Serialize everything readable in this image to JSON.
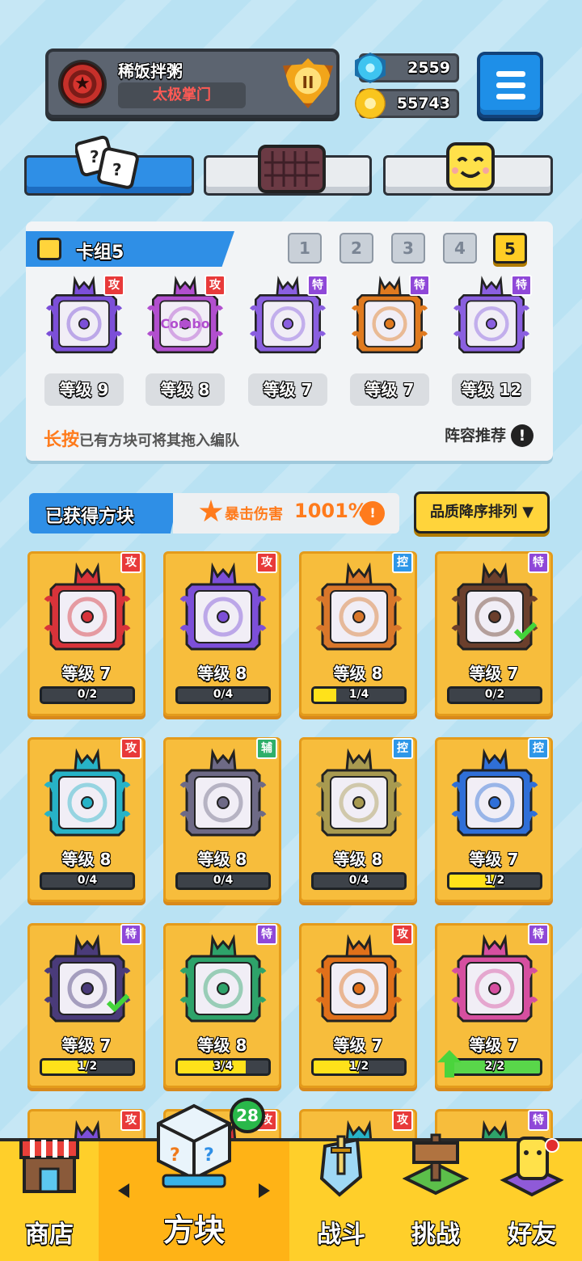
{
  "player": {
    "name": "稀饭拌粥",
    "guild": "太极掌门",
    "rank_label": "II"
  },
  "currency": {
    "gems": "2559",
    "coins": "55743"
  },
  "deck": {
    "title": "卡组5",
    "slots": [
      "1",
      "2",
      "3",
      "4",
      "5"
    ],
    "active_slot": "5",
    "cards": [
      {
        "tag": "攻",
        "level": "等级 9",
        "color": "#7c4fd8",
        "label": ""
      },
      {
        "tag": "攻",
        "level": "等级 8",
        "color": "#b24fcf",
        "label": "Combo"
      },
      {
        "tag": "特",
        "level": "等级 7",
        "color": "#8a5fe0",
        "label": ""
      },
      {
        "tag": "特",
        "level": "等级 7",
        "color": "#e07a1f",
        "label": ""
      },
      {
        "tag": "特",
        "level": "等级 12",
        "color": "#8a5fe0",
        "label": ""
      }
    ],
    "hint_highlight": "长按",
    "hint_text": "已有方块可将其拖入编队",
    "recommend_label": "阵容推荐"
  },
  "owned": {
    "title": "已获得方块",
    "crit_label": "暴击伤害",
    "crit_value": "1001%",
    "sort_label": "品质降序排列 ▼"
  },
  "blocks": [
    {
      "tag": "攻",
      "tag_type": "atk",
      "level": "等级 7",
      "progress": "0/2",
      "fill": 0,
      "color": "#d8333a",
      "equipped": false,
      "upgrade": false
    },
    {
      "tag": "攻",
      "tag_type": "atk",
      "level": "等级 8",
      "progress": "0/4",
      "fill": 0,
      "color": "#7c4fd8",
      "equipped": false,
      "upgrade": false
    },
    {
      "tag": "控",
      "tag_type": "ctl",
      "level": "等级 8",
      "progress": "1/4",
      "fill": 0.25,
      "color": "#d9772a",
      "equipped": false,
      "upgrade": false
    },
    {
      "tag": "特",
      "tag_type": "spc",
      "level": "等级 7",
      "progress": "0/2",
      "fill": 0,
      "color": "#6b3f2c",
      "equipped": true,
      "upgrade": false
    },
    {
      "tag": "攻",
      "tag_type": "atk",
      "level": "等级 8",
      "progress": "0/4",
      "fill": 0,
      "color": "#27b3c7",
      "equipped": false,
      "upgrade": false
    },
    {
      "tag": "辅",
      "tag_type": "sup",
      "level": "等级 8",
      "progress": "0/4",
      "fill": 0,
      "color": "#6e6a86",
      "equipped": false,
      "upgrade": false
    },
    {
      "tag": "控",
      "tag_type": "ctl",
      "level": "等级 8",
      "progress": "0/4",
      "fill": 0,
      "color": "#a89a50",
      "equipped": false,
      "upgrade": false
    },
    {
      "tag": "控",
      "tag_type": "ctl",
      "level": "等级 7",
      "progress": "1/2",
      "fill": 0.5,
      "color": "#2f6fd8",
      "equipped": false,
      "upgrade": false
    },
    {
      "tag": "特",
      "tag_type": "spc",
      "level": "等级 7",
      "progress": "1/2",
      "fill": 0.5,
      "color": "#4a3b7a",
      "equipped": true,
      "upgrade": false
    },
    {
      "tag": "特",
      "tag_type": "spc",
      "level": "等级 8",
      "progress": "3/4",
      "fill": 0.75,
      "color": "#2ea36a",
      "equipped": false,
      "upgrade": false
    },
    {
      "tag": "攻",
      "tag_type": "atk",
      "level": "等级 7",
      "progress": "1/2",
      "fill": 0.5,
      "color": "#e0701a",
      "equipped": false,
      "upgrade": false
    },
    {
      "tag": "特",
      "tag_type": "spc",
      "level": "等级 7",
      "progress": "2/2",
      "fill": 1,
      "color": "#d64fa0",
      "equipped": false,
      "upgrade": true
    },
    {
      "tag": "攻",
      "tag_type": "atk",
      "level": "",
      "progress": "",
      "fill": 0,
      "color": "#7c4fd8",
      "equipped": false,
      "upgrade": false
    },
    {
      "tag": "攻",
      "tag_type": "atk",
      "level": "",
      "progress": "",
      "fill": 0,
      "color": "#d8333a",
      "equipped": false,
      "upgrade": false
    },
    {
      "tag": "攻",
      "tag_type": "atk",
      "level": "",
      "progress": "",
      "fill": 0,
      "color": "#27b3c7",
      "equipped": false,
      "upgrade": false
    },
    {
      "tag": "特",
      "tag_type": "spc",
      "level": "",
      "progress": "",
      "fill": 0,
      "color": "#2ea36a",
      "equipped": false,
      "upgrade": false
    }
  ],
  "nav": {
    "shop": "商店",
    "blocks": "方块",
    "battle": "战斗",
    "challenge": "挑战",
    "friends": "好友",
    "blocks_badge": "28"
  },
  "colors": {
    "primary_blue": "#2f8fe6",
    "gold": "#ffcf2a",
    "card_bg": "#f7bd3c",
    "accent_orange": "#ff7b1c"
  }
}
